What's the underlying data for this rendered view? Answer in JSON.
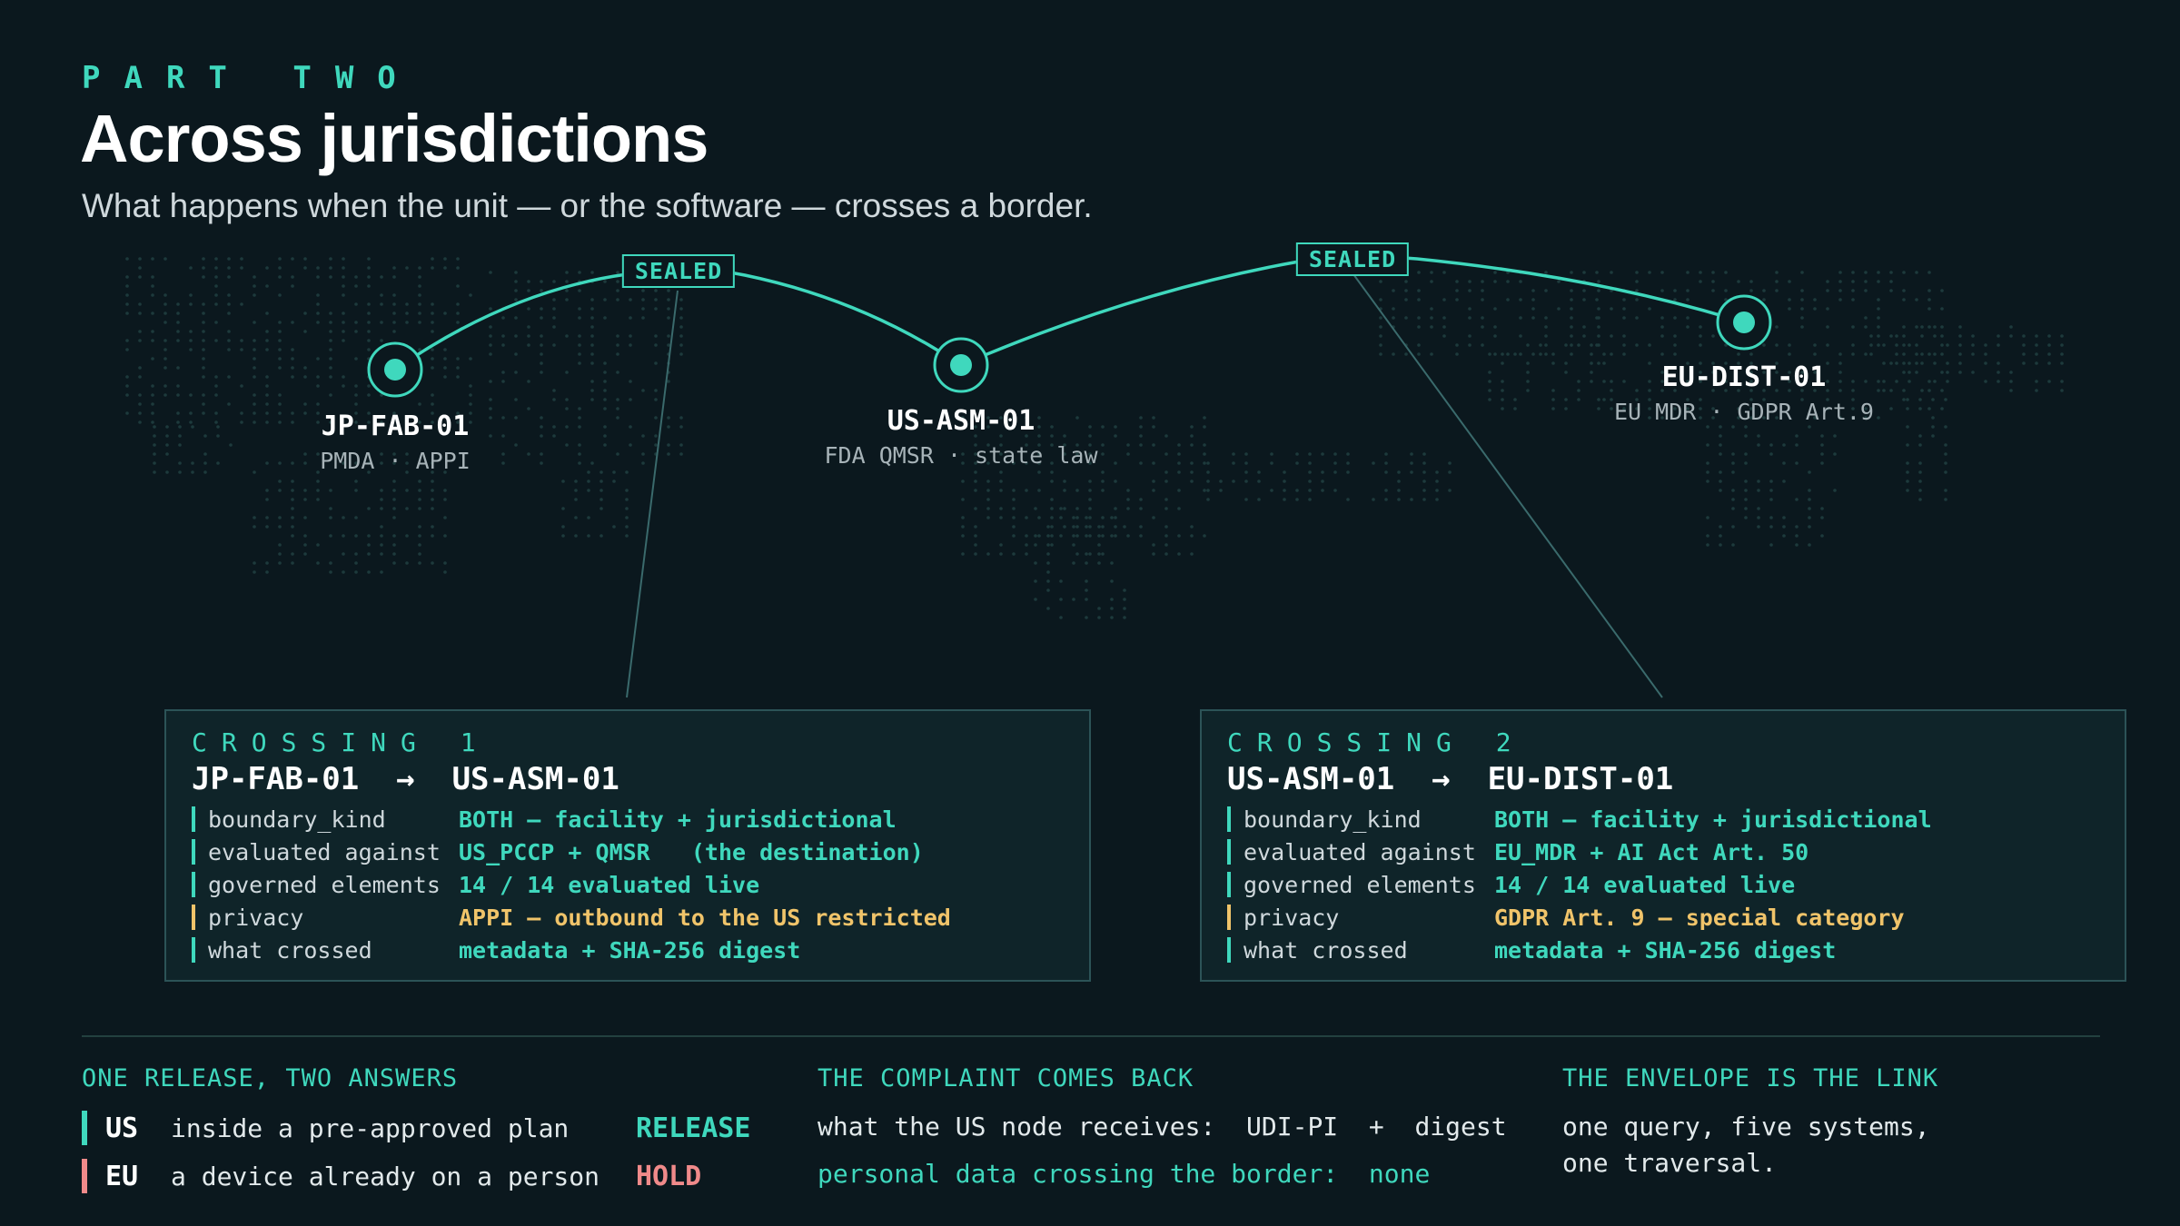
{
  "header": {
    "eyebrow": "PART TWO",
    "title": "Across jurisdictions",
    "subtitle": "What happens when the unit — or the software — crosses a border."
  },
  "nodes": [
    {
      "id": "JP-FAB-01",
      "sub": "PMDA · APPI"
    },
    {
      "id": "US-ASM-01",
      "sub": "FDA QMSR · state law"
    },
    {
      "id": "EU-DIST-01",
      "sub": "EU MDR · GDPR Art.9"
    }
  ],
  "badges": [
    "SEALED",
    "SEALED"
  ],
  "crossings": [
    {
      "eyebrow": "CROSSING 1",
      "route": "JP-FAB-01  →  US-ASM-01",
      "rows": [
        {
          "key": "boundary_kind",
          "value": "BOTH — facility + jurisdictional",
          "tone": "ok"
        },
        {
          "key": "evaluated against",
          "value": "US_PCCP + QMSR   (the destination)",
          "tone": "ok"
        },
        {
          "key": "governed elements",
          "value": "14 / 14 evaluated live",
          "tone": "ok"
        },
        {
          "key": "privacy",
          "value": "APPI — outbound to the US restricted",
          "tone": "warn"
        },
        {
          "key": "what crossed",
          "value": "metadata + SHA-256 digest",
          "tone": "ok"
        }
      ]
    },
    {
      "eyebrow": "CROSSING 2",
      "route": "US-ASM-01  →  EU-DIST-01",
      "rows": [
        {
          "key": "boundary_kind",
          "value": "BOTH — facility + jurisdictional",
          "tone": "ok"
        },
        {
          "key": "evaluated against",
          "value": "EU_MDR + AI Act Art. 50",
          "tone": "ok"
        },
        {
          "key": "governed elements",
          "value": "14 / 14 evaluated live",
          "tone": "ok"
        },
        {
          "key": "privacy",
          "value": "GDPR Art. 9 — special category",
          "tone": "warn"
        },
        {
          "key": "what crossed",
          "value": "metadata + SHA-256 digest",
          "tone": "ok"
        }
      ]
    }
  ],
  "bottom": {
    "release": {
      "heading": "ONE RELEASE, TWO ANSWERS",
      "rows": [
        {
          "code": "US",
          "desc": "inside a pre-approved plan",
          "verdict": "RELEASE",
          "color": "#3fd8bd"
        },
        {
          "code": "EU",
          "desc": "a device already on a person",
          "verdict": "HOLD",
          "color": "#f08a8a"
        }
      ]
    },
    "complaint": {
      "heading": "THE COMPLAINT COMES BACK",
      "line1": "what the US node receives:  UDI-PI  +  digest",
      "line2": "personal data crossing the border:  none"
    },
    "envelope": {
      "heading": "THE ENVELOPE IS THE LINK",
      "line1": "one query, five systems,",
      "line2": "one traversal."
    }
  },
  "colors": {
    "accent": "#3fd8bd",
    "warn": "#f0c46a",
    "hold": "#f08a8a",
    "background": "#0b181e"
  }
}
